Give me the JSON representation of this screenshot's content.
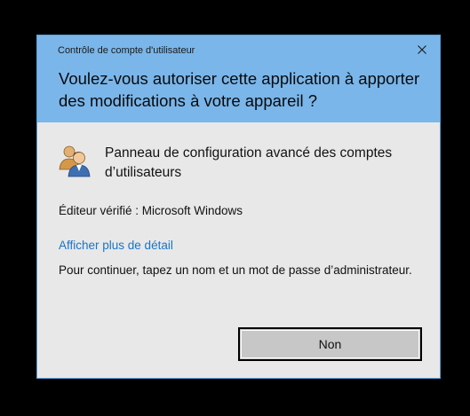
{
  "window": {
    "title": "Contrôle de compte d'utilisateur",
    "close_icon": "close-icon"
  },
  "prompt": {
    "question": "Voulez-vous autoriser cette application à apporter des modifications à votre appareil ?"
  },
  "app": {
    "icon": "users-icon",
    "name": "Panneau de configuration avancé des comptes d’utilisateurs",
    "publisher": "Éditeur vérifié : Microsoft Windows"
  },
  "details": {
    "link_label": "Afficher plus de détail"
  },
  "instruction": "Pour continuer, tapez un nom et un mot de passe d’administrateur.",
  "buttons": {
    "no_label": "Non"
  },
  "colors": {
    "header": "#7ab6ea",
    "body": "#e8e8e8",
    "link": "#1a74c8",
    "button": "#c7c7c7"
  }
}
